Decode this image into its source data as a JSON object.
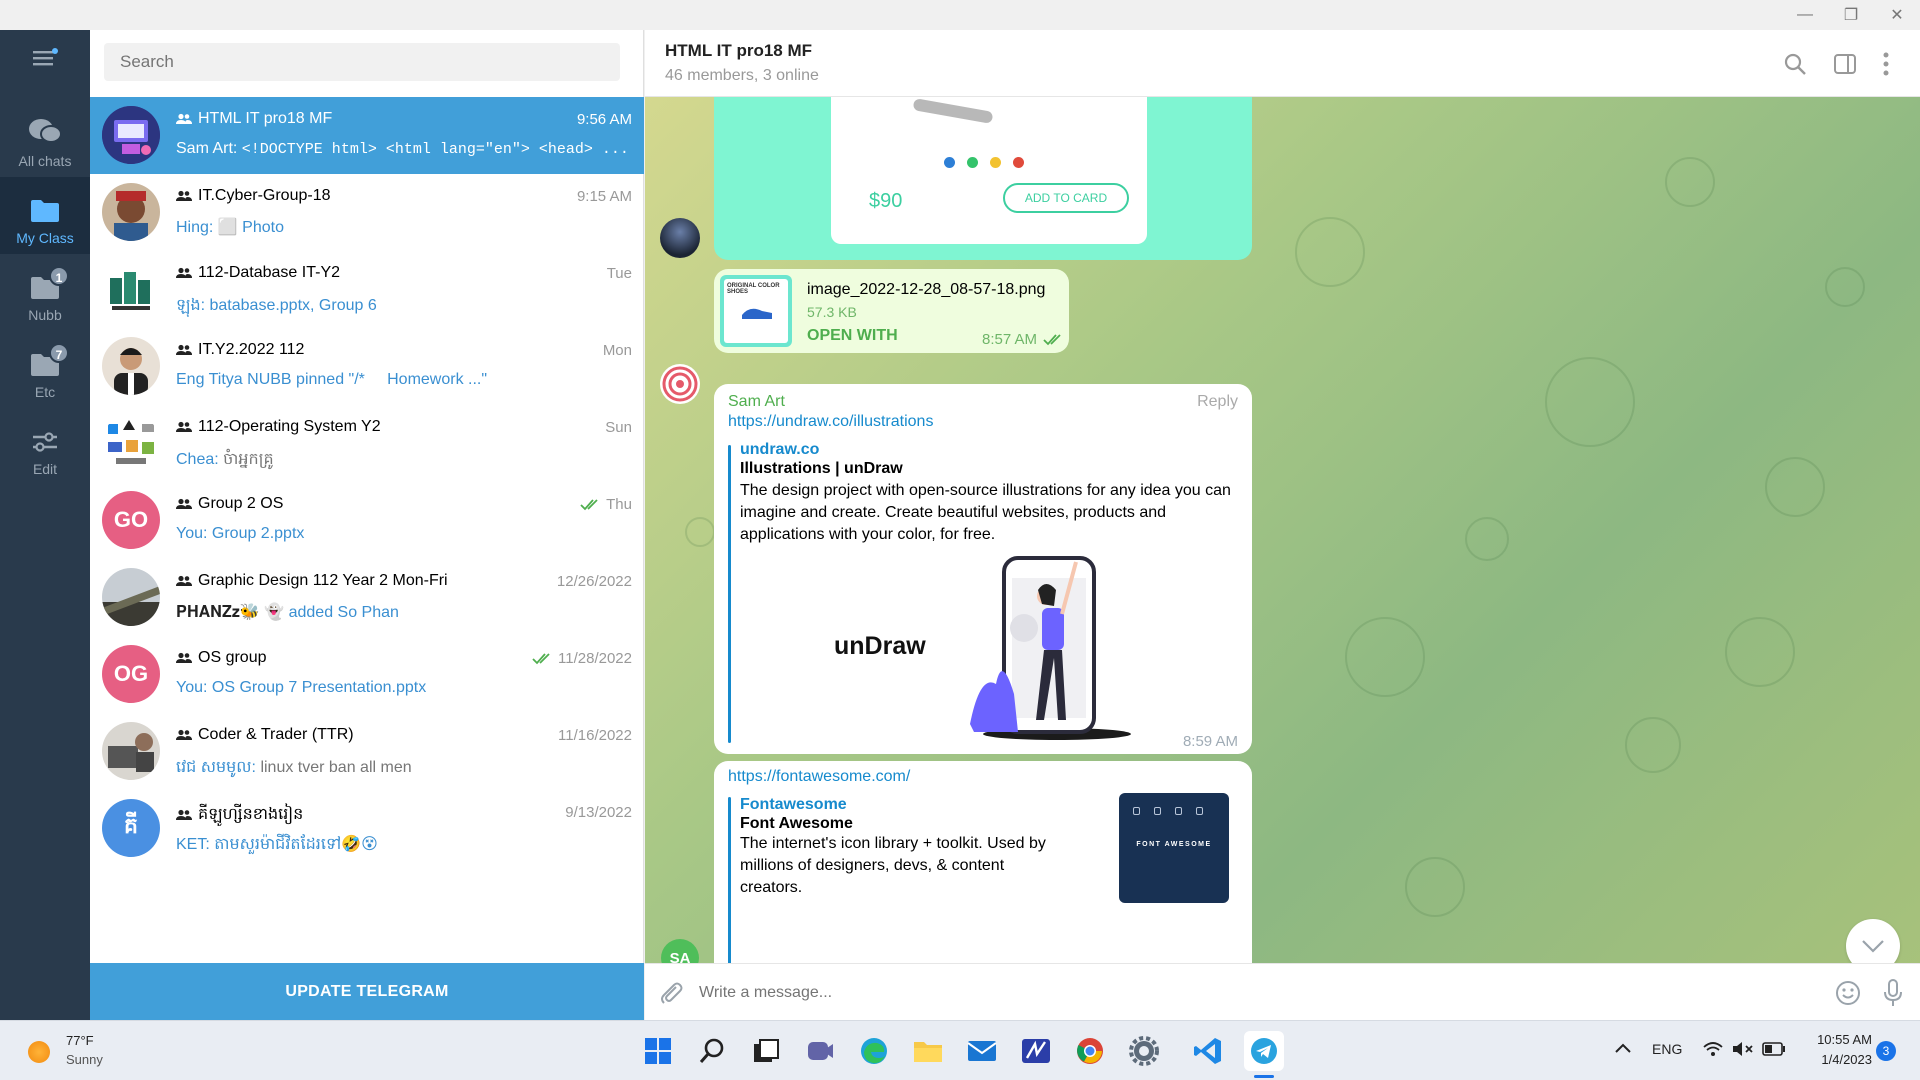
{
  "window": {
    "minimize": "—",
    "restore": "❐",
    "close": "✕"
  },
  "rail": {
    "folders": [
      {
        "label": "All chats",
        "badge": ""
      },
      {
        "label": "My Class",
        "badge": ""
      },
      {
        "label": "Nubb",
        "badge": "1"
      },
      {
        "label": "Etc",
        "badge": "7"
      },
      {
        "label": "Edit",
        "badge": ""
      }
    ]
  },
  "search": {
    "placeholder": "Search"
  },
  "chats": [
    {
      "name": "HTML IT pro18 MF",
      "time": "9:56 AM",
      "sender": "Sam Art: ",
      "preview": "<!DOCTYPE html> <html lang=\"en\"> <head> ...",
      "selected": true
    },
    {
      "name": "IT.Cyber-Group-18",
      "time": "9:15 AM",
      "sender": "Hing: ",
      "preview": "⬜ Photo"
    },
    {
      "name": "112-Database IT-Y2",
      "time": "Tue",
      "sender": "ឡុង: ",
      "preview": "batabase.pptx, Group 6"
    },
    {
      "name": "IT.Y2.2022 112",
      "time": "Mon",
      "sender": "Eng Titya NUBB pinned \"/*     Homework ...\"",
      "preview": ""
    },
    {
      "name": "112-Operating System Y2",
      "time": "Sun",
      "sender": "Chea: ",
      "preview": "ចំាអ្នកគ្រូ"
    },
    {
      "name": "Group 2 OS",
      "time": "Thu",
      "sender": "You: ",
      "preview": "Group 2.pptx",
      "initials": "GO"
    },
    {
      "name": "Graphic Design 112 Year 2 Mon-Fri",
      "time": "12/26/2022",
      "sender": "𝐏𝐇𝐀𝐍𝐙𝐳🐝 👻 ",
      "preview": "added So Phan"
    },
    {
      "name": "OS group",
      "time": "11/28/2022",
      "sender": "You: ",
      "preview": "OS Group 7 Presentation.pptx",
      "initials": "OG"
    },
    {
      "name": "Coder & Trader (TTR)",
      "time": "11/16/2022",
      "sender": "វេជ សមមូល: ",
      "preview": "linux tver ban all men"
    },
    {
      "name": "គីឡូហ្សីនខាងរៀន",
      "time": "9/13/2022",
      "sender": "KET: ",
      "preview": "តាមសួរម៉ាជីវិតដែរទៅ🤣😵",
      "initials": "គី"
    }
  ],
  "update_button": "UPDATE TELEGRAM",
  "chat": {
    "title": "HTML IT pro18 MF",
    "subtitle": "46 members, 3 online",
    "product": {
      "price": "$90",
      "button": "ADD TO CARD"
    },
    "file": {
      "name": "image_2022-12-28_08-57-18.png",
      "size": "57.3 KB",
      "action": "OPEN WITH",
      "time": "8:57 AM",
      "thumb_title": "ORIGINAL COLOR SHOES"
    },
    "msg1": {
      "sender": "Sam Art",
      "reply": "Reply",
      "url": "https://undraw.co/illustrations",
      "site": "undraw.co",
      "title": "Illustrations | unDraw",
      "desc": "The design project with open-source illustrations for any idea you can imagine and create. Create beautiful websites, products and applications with your color, for free.",
      "brand": "unDraw",
      "time": "8:59 AM"
    },
    "msg2": {
      "url": "https://fontawesome.com/",
      "site": "Fontawesome",
      "title": "Font Awesome",
      "desc": "The internet's icon library + toolkit. Used by millions of designers, devs, & content creators.",
      "thumb_text": "FONT AWESOME"
    },
    "avatar_sa": "SA",
    "composer_placeholder": "Write a message..."
  },
  "taskbar": {
    "temp": "77°F",
    "weather": "Sunny",
    "lang": "ENG",
    "time": "10:55 AM",
    "date": "1/4/2023",
    "notif": "3"
  },
  "colors": {
    "accent": "#419fd9",
    "rail": "#293a4c",
    "link": "#168acd",
    "online_green": "#4fae4e"
  }
}
